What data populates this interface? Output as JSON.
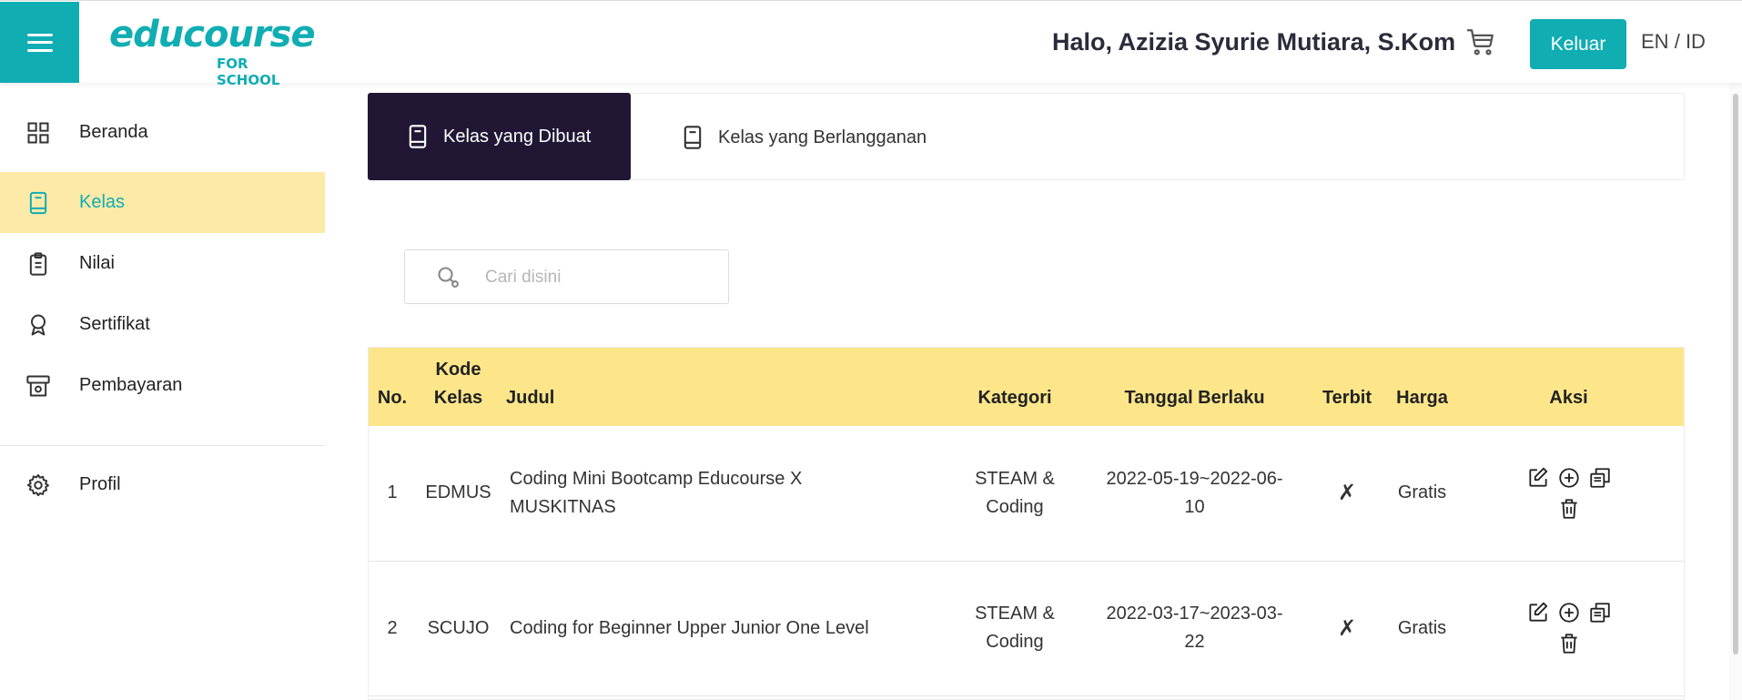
{
  "header": {
    "logo_text": "educourse",
    "logo_sub": "FOR SCHOOL",
    "greeting": "Halo, Azizia Syurie Mutiara, S.Kom",
    "logout_label": "Keluar",
    "lang_en": "EN",
    "lang_sep": "/",
    "lang_id": "ID"
  },
  "colors": {
    "brand": "#10adb3",
    "active_bg": "#fdeaa8",
    "tab_active": "#211735",
    "table_head": "#fde68a"
  },
  "sidebar": {
    "items": [
      {
        "label": "Beranda",
        "icon": "grid-icon"
      },
      {
        "label": "Kelas",
        "icon": "book-icon",
        "active": true
      },
      {
        "label": "Nilai",
        "icon": "clipboard-icon"
      },
      {
        "label": "Sertifikat",
        "icon": "award-icon"
      },
      {
        "label": "Pembayaran",
        "icon": "payment-icon"
      },
      {
        "label": "Profil",
        "icon": "gear-icon"
      }
    ]
  },
  "tabs": [
    {
      "label": "Kelas yang Dibuat",
      "active": true
    },
    {
      "label": "Kelas yang Berlangganan",
      "active": false
    }
  ],
  "search": {
    "placeholder": "Cari disini",
    "value": ""
  },
  "table": {
    "headers": {
      "no": "No.",
      "kode_line1": "Kode",
      "kode_line2": "Kelas",
      "judul": "Judul",
      "kategori": "Kategori",
      "tanggal": "Tanggal Berlaku",
      "terbit": "Terbit",
      "harga": "Harga",
      "aksi": "Aksi"
    },
    "rows": [
      {
        "no": "1",
        "kode": "EDMUS",
        "judul": "Coding Mini Bootcamp Educourse X MUSKITNAS",
        "kategori": "STEAM & Coding",
        "tanggal": "2022-05-19~2022-06-10",
        "terbit": "✗",
        "harga": "Gratis"
      },
      {
        "no": "2",
        "kode": "SCUJO",
        "judul": "Coding for Beginner Upper Junior One Level",
        "kategori": "STEAM & Coding",
        "tanggal": "2022-03-17~2023-03-22",
        "terbit": "✗",
        "harga": "Gratis"
      }
    ]
  }
}
